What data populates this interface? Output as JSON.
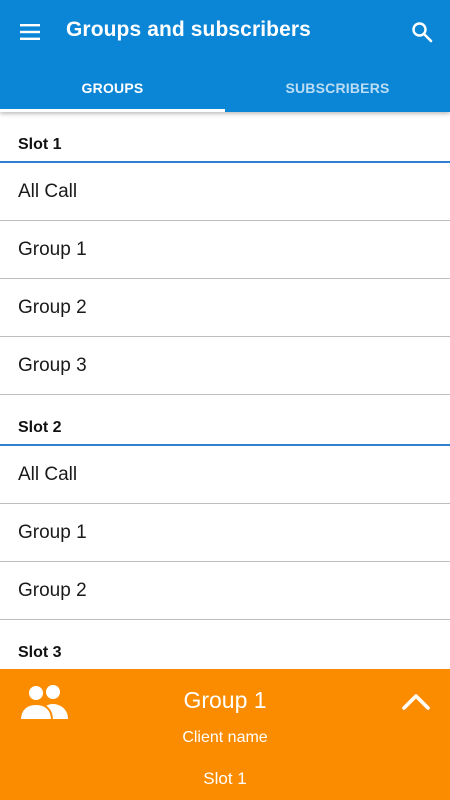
{
  "app_bar": {
    "title": "Groups and subscribers",
    "menu_icon": "hamburger-menu-icon",
    "search_icon": "search-icon",
    "background_color": "#0b86d6"
  },
  "tabs": [
    {
      "label": "GROUPS",
      "selected": true
    },
    {
      "label": "SUBSCRIBERS",
      "selected": false
    }
  ],
  "sections": [
    {
      "header": "Slot 1",
      "items": [
        "All Call",
        "Group 1",
        "Group 2",
        "Group 3"
      ]
    },
    {
      "header": "Slot 2",
      "items": [
        "All Call",
        "Group 1",
        "Group 2"
      ]
    },
    {
      "header": "Slot 3",
      "items": []
    }
  ],
  "now_selected": {
    "group_name": "Group 1",
    "client_name": "Client name",
    "slot": "Slot 1",
    "group_icon": "group-people-icon",
    "expand_icon": "chevron-up-icon",
    "background_color": "#fb8c00"
  }
}
